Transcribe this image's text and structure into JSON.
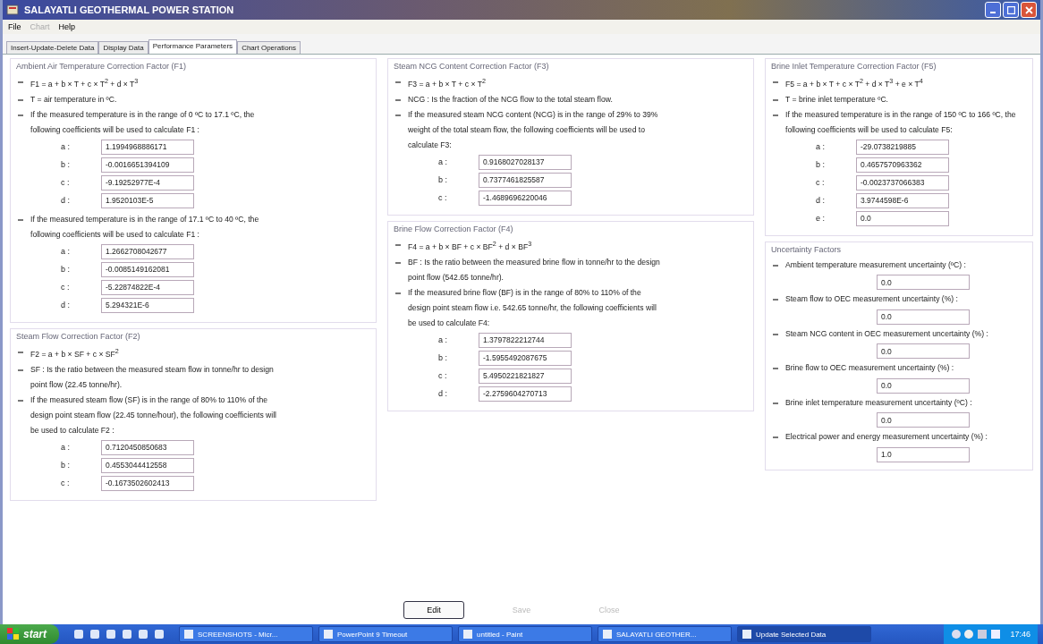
{
  "window": {
    "title": "SALAYATLI GEOTHERMAL POWER STATION"
  },
  "menu": [
    {
      "label": "File",
      "disabled": false
    },
    {
      "label": "Chart",
      "disabled": true
    },
    {
      "label": "Help",
      "disabled": false
    }
  ],
  "tabs": [
    {
      "label": "Insert-Update-Delete Data",
      "selected": false
    },
    {
      "label": "Display Data",
      "selected": false
    },
    {
      "label": "Performance Parameters",
      "selected": true
    },
    {
      "label": "Chart Operations",
      "selected": false
    }
  ],
  "columns": [
    [
      {
        "title": "Ambient Air Temperature Correction Factor (F1)",
        "kind": "factor",
        "blocks": [
          {
            "kind": "bullet",
            "text": "F1 = a + b × T + c × T$^{2}$ + d × T$^{3}$"
          },
          {
            "kind": "bullet",
            "text": "T = air temperature in ºC."
          },
          {
            "kind": "bullet",
            "text": "If the measured temperature is in the range of 0 ºC to 17.1 ºC, the following coefficients will be used to calculate F1 :"
          },
          {
            "kind": "coefficients",
            "rows": [
              {
                "label": "a :",
                "value": "1.1994968886171"
              },
              {
                "label": "b :",
                "value": "-0.0016651394109"
              },
              {
                "label": "c :",
                "value": "-9.19252977E-4"
              },
              {
                "label": "d :",
                "value": "1.9520103E-5"
              }
            ]
          },
          {
            "kind": "bullet",
            "text": "If the measured temperature is in the range of 17.1 ºC to 40 ºC, the following coefficients will be used to calculate F1 :"
          },
          {
            "kind": "coefficients",
            "rows": [
              {
                "label": "a :",
                "value": "1.2662708042677"
              },
              {
                "label": "b :",
                "value": "-0.0085149162081"
              },
              {
                "label": "c :",
                "value": "-5.22874822E-4"
              },
              {
                "label": "d :",
                "value": "5.294321E-6"
              }
            ]
          }
        ]
      },
      {
        "title": "Steam Flow Correction Factor (F2)",
        "kind": "factor",
        "blocks": [
          {
            "kind": "bullet",
            "text": "F2 = a + b × SF + c × SF$^{2}$"
          },
          {
            "kind": "bullet",
            "text": "SF : Is the ratio between the measured steam flow in tonne/hr to design point flow (22.45 tonne/hr)."
          },
          {
            "kind": "bullet",
            "text": "If the measured steam flow (SF) is in the range of 80% to 110% of the design point steam flow (22.45 tonne/hour), the following coefficients will be used to calculate F2 :"
          },
          {
            "kind": "coefficients",
            "rows": [
              {
                "label": "a :",
                "value": "0.7120450850683"
              },
              {
                "label": "b :",
                "value": "0.4553044412558"
              },
              {
                "label": "c :",
                "value": "-0.1673502602413"
              }
            ]
          }
        ]
      }
    ],
    [
      {
        "title": "Steam NCG Content Correction Factor (F3)",
        "kind": "factor",
        "blocks": [
          {
            "kind": "bullet",
            "text": "F3 = a + b × T + c × T$^{2}$"
          },
          {
            "kind": "bullet",
            "text": "NCG : Is the fraction of the NCG flow to the total steam flow."
          },
          {
            "kind": "bullet",
            "text": "If the measured steam NCG content (NCG) is in the range of 29% to 39% weight of the total steam flow, the following coefficients will be used to calculate F3:"
          },
          {
            "kind": "coefficients",
            "rows": [
              {
                "label": "a :",
                "value": "0.9168027028137"
              },
              {
                "label": "b :",
                "value": "0.7377461825587"
              },
              {
                "label": "c :",
                "value": "-1.4689696220046"
              }
            ]
          }
        ]
      },
      {
        "title": "Brine Flow Correction Factor (F4)",
        "kind": "factor",
        "blocks": [
          {
            "kind": "bullet",
            "text": "F4 = a + b × BF + c × BF$^{2}$ + d × BF$^{3}$"
          },
          {
            "kind": "bullet",
            "text": "BF : Is the ratio between the measured brine flow in tonne/hr to the design point flow (542.65 tonne/hr)."
          },
          {
            "kind": "bullet",
            "text": "If the measured brine flow (BF) is in the range of 80% to 110% of the design point steam flow i.e. 542.65 tonne/hr, the following coefficients will be used to calculate F4:"
          },
          {
            "kind": "coefficients",
            "rows": [
              {
                "label": "a :",
                "value": "1.3797822212744"
              },
              {
                "label": "b :",
                "value": "-1.5955492087675"
              },
              {
                "label": "c :",
                "value": "5.4950221821827"
              },
              {
                "label": "d :",
                "value": "-2.2759604270713"
              }
            ]
          }
        ]
      }
    ],
    [
      {
        "title": "Brine Inlet Temperature Correction Factor (F5)",
        "kind": "factor",
        "blocks": [
          {
            "kind": "bullet",
            "text": "F5 = a + b × T + c × T$^{2}$ + d × T$^{3}$ + e × T$^{4}$"
          },
          {
            "kind": "bullet",
            "text": "T = brine inlet temperature ºC."
          },
          {
            "kind": "bullet",
            "text": "If the measured temperature is in the range of 150 ºC to 166 ºC, the following coefficients will be used to calculate F5:"
          },
          {
            "kind": "coefficients",
            "rows": [
              {
                "label": "a :",
                "value": "-29.0738219885"
              },
              {
                "label": "b :",
                "value": "0.4657570963362"
              },
              {
                "label": "c :",
                "value": "-0.0023737066383"
              },
              {
                "label": "d :",
                "value": "3.9744598E-6"
              },
              {
                "label": "e :",
                "value": "0.0"
              }
            ]
          }
        ]
      },
      {
        "title": "Uncertainty Factors",
        "kind": "uncertainty",
        "items": [
          {
            "label": "Ambient temperature measurement uncertainty (ºC) :",
            "value": "0.0"
          },
          {
            "label": "Steam flow to OEC measurement uncertainty (%) :",
            "value": "0.0"
          },
          {
            "label": "Steam NCG content in OEC measurement uncertainty (%) :",
            "value": "0.0"
          },
          {
            "label": "Brine flow to OEC measurement uncertainty (%) :",
            "value": "0.0"
          },
          {
            "label": "Brine inlet temperature measurement uncertainty (ºC) :",
            "value": "0.0"
          },
          {
            "label": "Electrical power and energy measurement uncertainty (%) :",
            "value": "1.0"
          }
        ]
      }
    ]
  ],
  "buttons": [
    {
      "label": "Edit",
      "disabled": false
    },
    {
      "label": "Save",
      "disabled": true
    },
    {
      "label": "Close",
      "disabled": true
    }
  ],
  "taskbar": {
    "start": "start",
    "tasks": [
      {
        "label": "SCREENSHOTS - Micr...",
        "selected": false
      },
      {
        "label": "PowerPoint 9 Timeout",
        "selected": false
      },
      {
        "label": "untitled - Paint",
        "selected": false
      },
      {
        "label": "SALAYATLI GEOTHER...",
        "selected": false
      },
      {
        "label": "Update Selected Data",
        "selected": true
      }
    ],
    "clock": "17:46"
  }
}
